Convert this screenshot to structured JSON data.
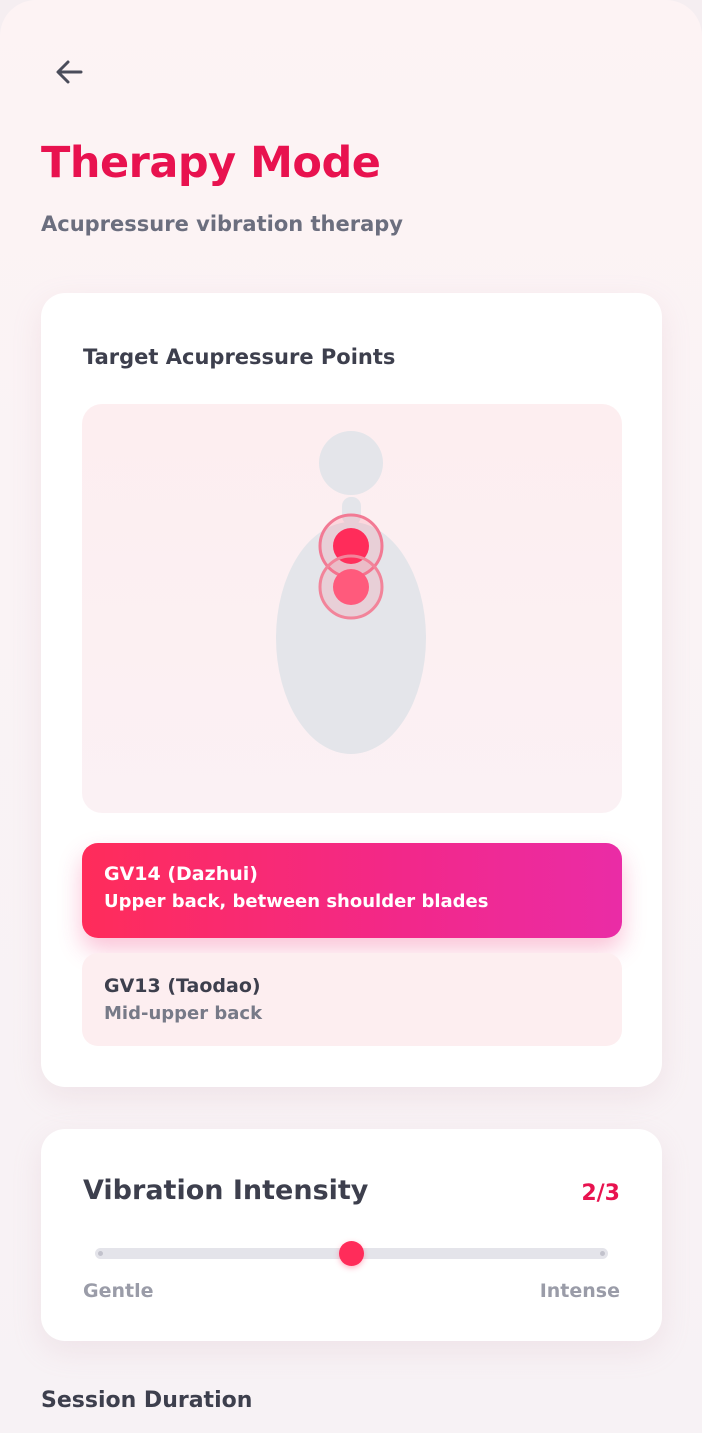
{
  "header": {
    "title": "Therapy Mode",
    "subtitle": "Acupressure vibration therapy",
    "back_icon": "arrow-left-icon"
  },
  "points_card": {
    "heading": "Target Acupressure Points",
    "points": [
      {
        "name": "GV14 (Dazhui)",
        "description": "Upper back, between shoulder blades",
        "selected": true
      },
      {
        "name": "GV13 (Taodao)",
        "description": "Mid-upper back",
        "selected": false
      }
    ]
  },
  "intensity": {
    "title": "Vibration Intensity",
    "value": "2/3",
    "level": 2,
    "max": 3,
    "min_label": "Gentle",
    "max_label": "Intense"
  },
  "next_section": {
    "heading": "Session Duration"
  },
  "colors": {
    "accent": "#e8124f",
    "active_gradient_start": "#ff2c5a",
    "active_gradient_end": "#ea2ca6",
    "text_dark": "#3d3f4d",
    "text_muted": "#6b6e7e"
  }
}
